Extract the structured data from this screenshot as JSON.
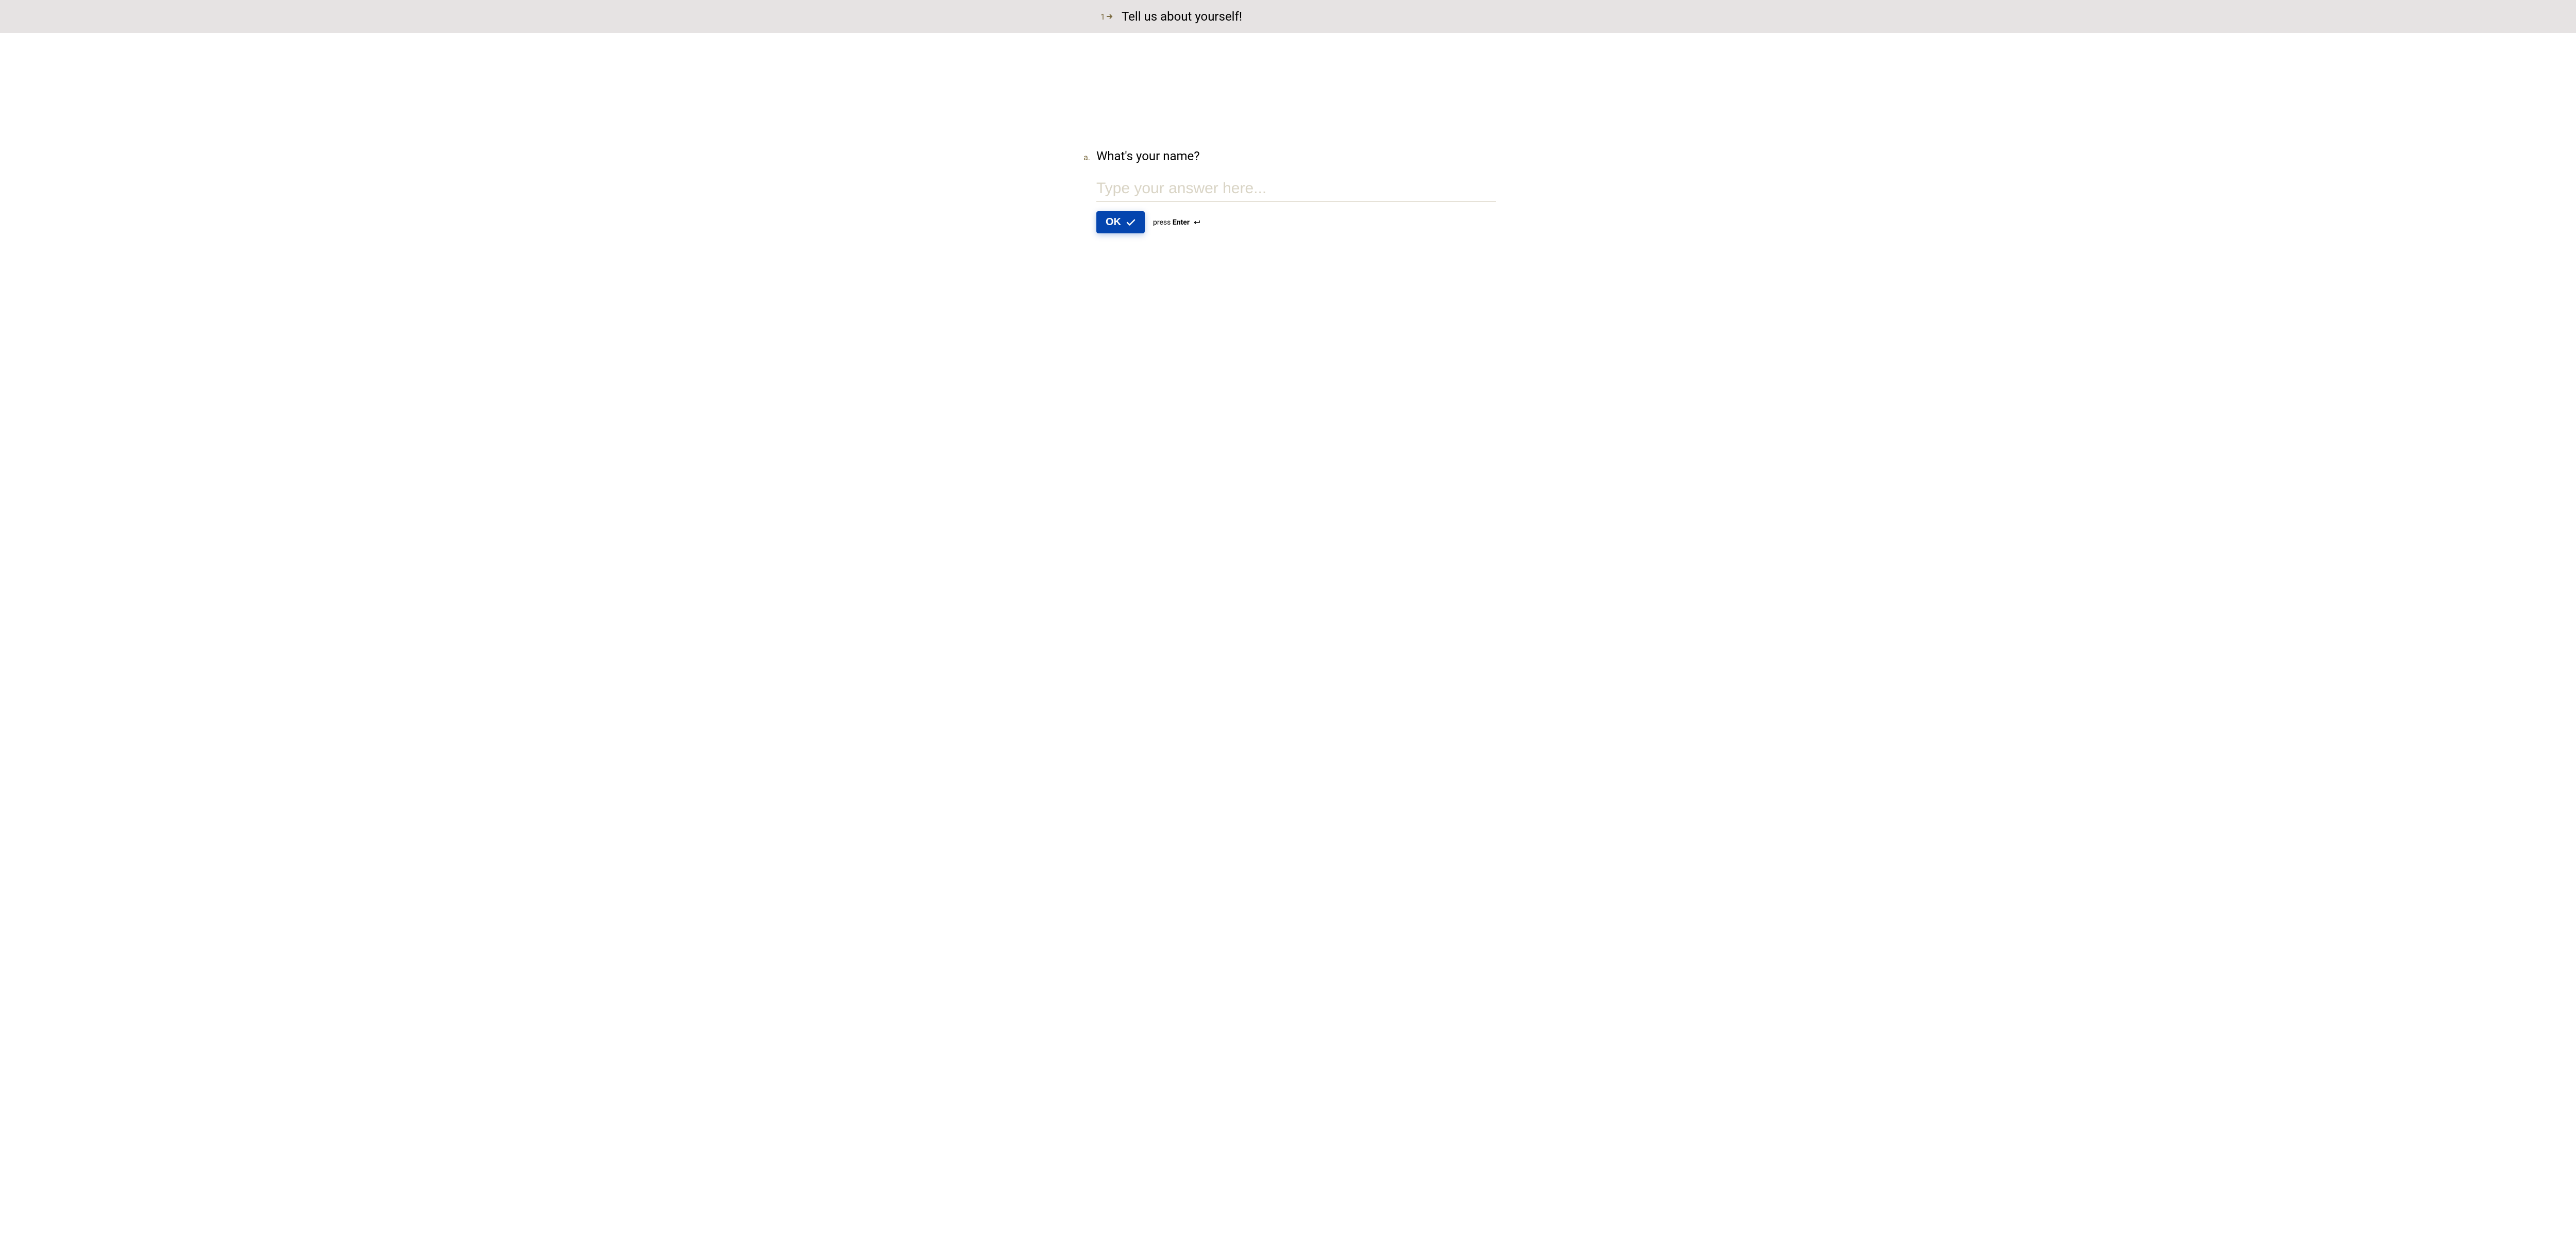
{
  "header": {
    "step_number": "1",
    "title": "Tell us about yourself!"
  },
  "question": {
    "letter": "a.",
    "text": "What's your name?",
    "placeholder": "Type your answer here..."
  },
  "actions": {
    "ok_label": "OK",
    "press_label": "press ",
    "enter_label": "Enter"
  }
}
